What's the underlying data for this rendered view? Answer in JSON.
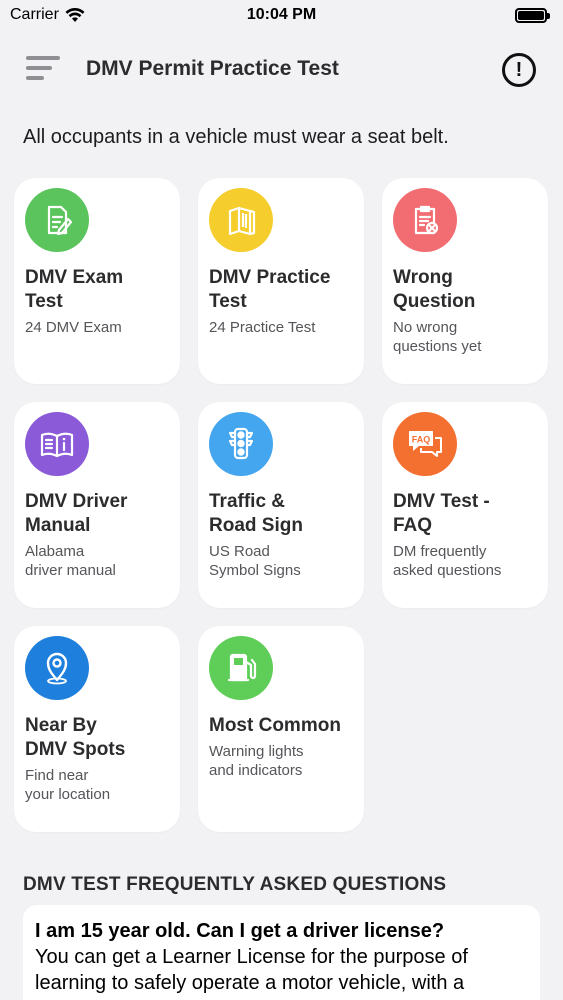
{
  "status_bar": {
    "carrier": "Carrier",
    "time": "10:04 PM"
  },
  "nav": {
    "title": "DMV Permit Practice Test"
  },
  "tip": "All occupants in a vehicle must wear a seat belt.",
  "cards": [
    {
      "title": "DMV Exam\nTest",
      "subtitle": "24 DMV Exam",
      "icon": "exam-icon",
      "color": "#5cc45c"
    },
    {
      "title": "DMV Practice\nTest",
      "subtitle": "24 Practice Test",
      "icon": "book-icon",
      "color": "#f5cd2c"
    },
    {
      "title": "Wrong\nQuestion",
      "subtitle": "No wrong\nquestions yet",
      "icon": "wrong-clipboard-icon",
      "color": "#f26d72"
    },
    {
      "title": "DMV Driver\nManual",
      "subtitle": "Alabama\ndriver manual",
      "icon": "manual-icon",
      "color": "#8a5ad8"
    },
    {
      "title": "Traffic &\nRoad Sign",
      "subtitle": "US Road\nSymbol Signs",
      "icon": "traffic-light-icon",
      "color": "#44a6ef"
    },
    {
      "title": "DMV Test  -\nFAQ",
      "subtitle": "DM frequently\nasked questions",
      "icon": "faq-icon",
      "color": "#f47030"
    },
    {
      "title": "Near By\nDMV Spots",
      "subtitle": "Find near\nyour location",
      "icon": "location-pin-icon",
      "color": "#1e7fdc"
    },
    {
      "title": "Most Common",
      "subtitle": "Warning lights\nand indicators",
      "icon": "fuel-pump-icon",
      "color": "#5fce58"
    }
  ],
  "faq": {
    "heading": "DMV TEST FREQUENTLY ASKED QUESTIONS",
    "question": "I am 15 year old. Can I get a driver license?",
    "answer": "You can get a Learner License for the purpose of learning to safely operate a motor vehicle, with a"
  }
}
